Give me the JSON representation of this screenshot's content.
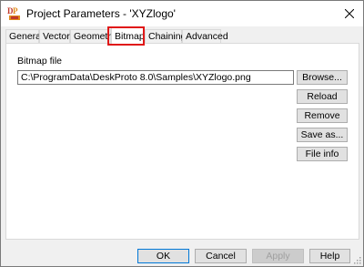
{
  "window": {
    "title": "Project Parameters - 'XYZlogo'",
    "app_icon": "deskproto-icon",
    "close_icon": "close-icon"
  },
  "tabs": [
    {
      "label": "General",
      "active": false
    },
    {
      "label": "Vector",
      "active": false
    },
    {
      "label": "Geometry",
      "active": false
    },
    {
      "label": "Bitmap",
      "active": true
    },
    {
      "label": "Chaining",
      "active": false
    },
    {
      "label": "Advanced",
      "active": false
    }
  ],
  "bitmap": {
    "file_label": "Bitmap file",
    "file_path": "C:\\ProgramData\\DeskProto 8.0\\Samples\\XYZlogo.png",
    "buttons": {
      "browse": "Browse...",
      "reload": "Reload",
      "remove": "Remove",
      "save_as": "Save as...",
      "file_info": "File info"
    }
  },
  "footer": {
    "ok": "OK",
    "cancel": "Cancel",
    "apply": "Apply",
    "help": "Help"
  },
  "colors": {
    "highlight": "#e01818",
    "default_button_border": "#0078d7"
  }
}
